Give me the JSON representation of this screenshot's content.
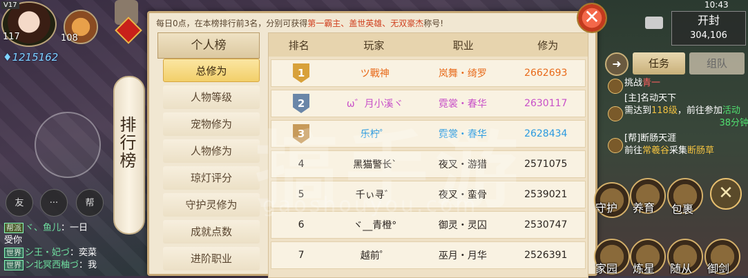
{
  "player": {
    "vip": "V17",
    "level": "117",
    "pet_level": "108",
    "power": "1215162"
  },
  "scroll_title": "排行榜",
  "chat_buttons": [
    "友",
    "帮"
  ],
  "chat": [
    {
      "tag": "帮派",
      "name": "ヾ、鱼儿",
      "text": "：一日"
    },
    {
      "tag": "",
      "name": "",
      "text": "受你"
    },
    {
      "tag": "世界",
      "name": "シ王・妃づ",
      "text": "：奕菜"
    },
    {
      "tag": "世界",
      "name": "ン北冥西柚づ",
      "text": "：我"
    }
  ],
  "panel": {
    "notice_prefix": "每日0点，在本榜排行前3名，分别可获得",
    "notice_titles": "第一霸主、盖世英雄、无双豪杰",
    "notice_suffix": "称号!",
    "close": "✕",
    "tab_header": "个人榜",
    "categories": [
      "总修为",
      "人物等级",
      "宠物修为",
      "人物修为",
      "琼灯评分",
      "守护灵修为",
      "成就点数",
      "进阶职业"
    ],
    "columns": [
      "排名",
      "玩家",
      "职业",
      "修为"
    ],
    "rows": [
      {
        "rank": "1",
        "player": "ツ戰神",
        "job": "岚舞・绮罗",
        "score": "2662693"
      },
      {
        "rank": "2",
        "player": "ω゛月小溪ヾ",
        "job": "霓裳・春华",
        "score": "2630117"
      },
      {
        "rank": "3",
        "player": "乐柠゜",
        "job": "霓裳・春华",
        "score": "2628434"
      },
      {
        "rank": "4",
        "player": "黑猫警长`",
        "job": "夜叉・游猎",
        "score": "2571075"
      },
      {
        "rank": "5",
        "player": "千ぃ寻゛",
        "job": "夜叉・蛮骨",
        "score": "2539021"
      },
      {
        "rank": "6",
        "player": "ヾ__青橙°",
        "job": "御灵・灵囚",
        "score": "2530747"
      },
      {
        "rank": "7",
        "player": "越前゜",
        "job": "巫月・月华",
        "score": "2526391"
      }
    ]
  },
  "hud": {
    "time": "10:43",
    "open_label": "开封",
    "open_coords": "304,106",
    "task_label": "任务",
    "team_label": "组队",
    "arrow": "➜",
    "tasks": [
      {
        "line1": "挑战青一",
        "line2": ""
      },
      {
        "line1": "[主]名动天下",
        "line2": "需达到118级，前往参加活动",
        "time": "38分钟"
      },
      {
        "line1": "[帮]断肠天涯",
        "line2": "前往常羲谷采集断肠草"
      }
    ],
    "skills": [
      "守护",
      "养育",
      "包裹",
      "家园",
      "炼星",
      "随从",
      "御剑"
    ],
    "close_x": "✕"
  },
  "watermark": {
    "big": "搞手游",
    "small": "gaoshouyou.com"
  }
}
